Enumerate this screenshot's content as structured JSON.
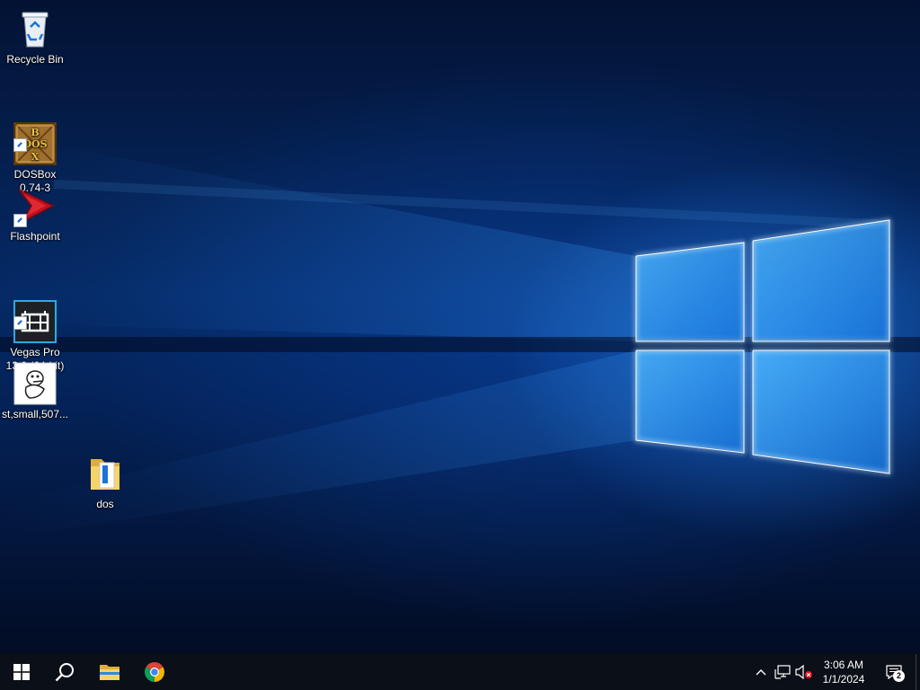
{
  "desktop": {
    "icons": [
      {
        "label": "Recycle Bin",
        "icon": "recycle-bin-icon"
      },
      {
        "label": "DOSBox\n0.74-3",
        "icon": "dosbox-icon",
        "shortcut": true,
        "logo_text": "DOSBOX"
      },
      {
        "label": "Flashpoint",
        "icon": "flashpoint-icon",
        "shortcut": true
      },
      {
        "label": "Vegas Pro\n13.0 (64-bit)",
        "icon": "vegas-pro-icon",
        "shortcut": true
      },
      {
        "label": "st,small,507...",
        "icon": "image-file-icon"
      },
      {
        "label": "dos",
        "icon": "folder-icon"
      }
    ]
  },
  "taskbar": {
    "start": "windows-start-icon",
    "search": "search-icon",
    "pinned": [
      "file-explorer-icon",
      "chrome-icon"
    ],
    "tray": {
      "overflow": "chevron-up-icon",
      "network": "network-icon",
      "volume": "volume-muted-icon",
      "time": "3:06 AM",
      "date": "1/1/2024",
      "notification_count": "2"
    }
  },
  "colors": {
    "taskbar": "#0b0f17",
    "accent": "#1a8cff",
    "desktop": "#052a66"
  }
}
